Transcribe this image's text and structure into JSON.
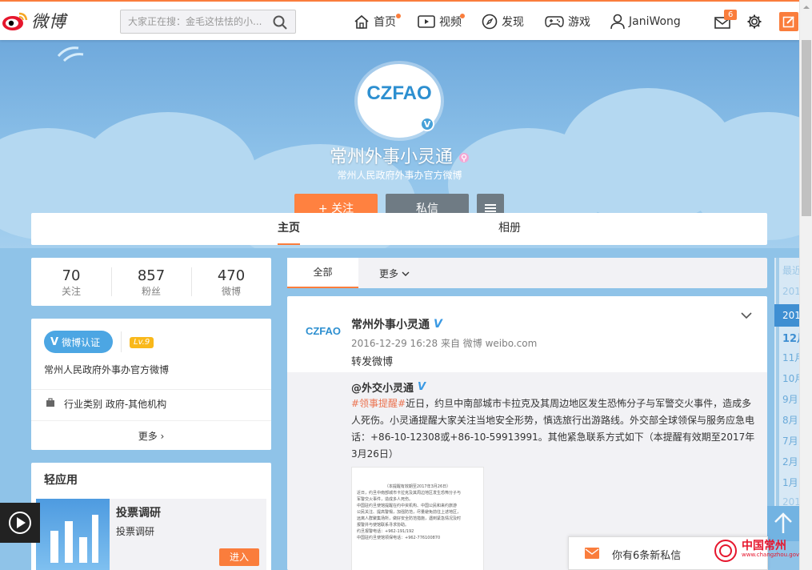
{
  "header": {
    "logo_text": "微博",
    "search_placeholder": "大家正在搜：金毛这怯怯的小...",
    "nav": [
      {
        "label": "首页"
      },
      {
        "label": "视频"
      },
      {
        "label": "发现"
      },
      {
        "label": "游戏"
      },
      {
        "label": "JaniWong"
      }
    ],
    "message_badge": "6",
    "accent_color": "#fa7d3c"
  },
  "profile": {
    "avatar_text": "CZFAO",
    "name": "常州外事小灵通",
    "description": "常州人民政府外事办官方微博",
    "follow_label": "+ 关注",
    "message_label": "私信",
    "follow_color": "#ff8140",
    "message_color": "#6f7b84"
  },
  "tabs": {
    "home": "主页",
    "album": "相册"
  },
  "stats": [
    {
      "value": "70",
      "label": "关注"
    },
    {
      "value": "857",
      "label": "粉丝"
    },
    {
      "value": "470",
      "label": "微博"
    }
  ],
  "verify_card": {
    "badge_label": "微博认证",
    "level": "Lv.9",
    "verify_text": "常州人民政府外事办官方微博",
    "industry_label": "行业类别",
    "industry_value": "政府-其他机构",
    "more_label": "更多 ›"
  },
  "apps_card": {
    "title": "轻应用",
    "app_name": "投票调研",
    "app_desc": "投票调研",
    "enter_label": "进入"
  },
  "feed_filter": {
    "all": "全部",
    "more": "更多"
  },
  "post": {
    "author": "常州外事小灵通",
    "meta": "2016-12-29 16:28 来自 微博 weibo.com",
    "text": "转发微博",
    "repost_author": "@外交小灵通",
    "repost_tag": "#领事提醒#",
    "repost_text": "近日，约旦中南部城市卡拉克及其周边地区发生恐怖分子与军警交火事件，造成多人死伤。小灵通提醒大家关注当地安全形势，慎选旅行出游路线。外交部全球领保与服务应急电话：+86-10-12308或+86-10-59913991。其他紧急联系方式如下（本提醒有效期至2017年3月26日）",
    "image_lines": [
      "（本提醒有效期至2017年3月26日）",
      "近日，约旦中南部城市卡拉克及其周边地区发生恐怖分子与",
      "军警交火事件，造成多人死伤。",
      "中国驻约旦使馆提醒在约中资机构、中国公民和来约旅游",
      "公民关注、提高警惕，加强防范，尽量避免前往上述地区，",
      "远离人群聚集场所，做好安全防范措施，遇到紧急情况及时",
      "报警并与使馆联系寻求协助。",
      "约旦报警电话：+962-191/192",
      "中国驻约旦使馆领保电话：+962-776100870"
    ]
  },
  "timeline": [
    "最近",
    "201",
    "201",
    "12月",
    "11月",
    "10月",
    "9月",
    "8月",
    "7月",
    "2月",
    "1月",
    "201"
  ],
  "message_bar": {
    "text": "你有6条新私信"
  },
  "watermark": {
    "text": "中国常州",
    "url": "www.changzhou.gov.cn"
  }
}
